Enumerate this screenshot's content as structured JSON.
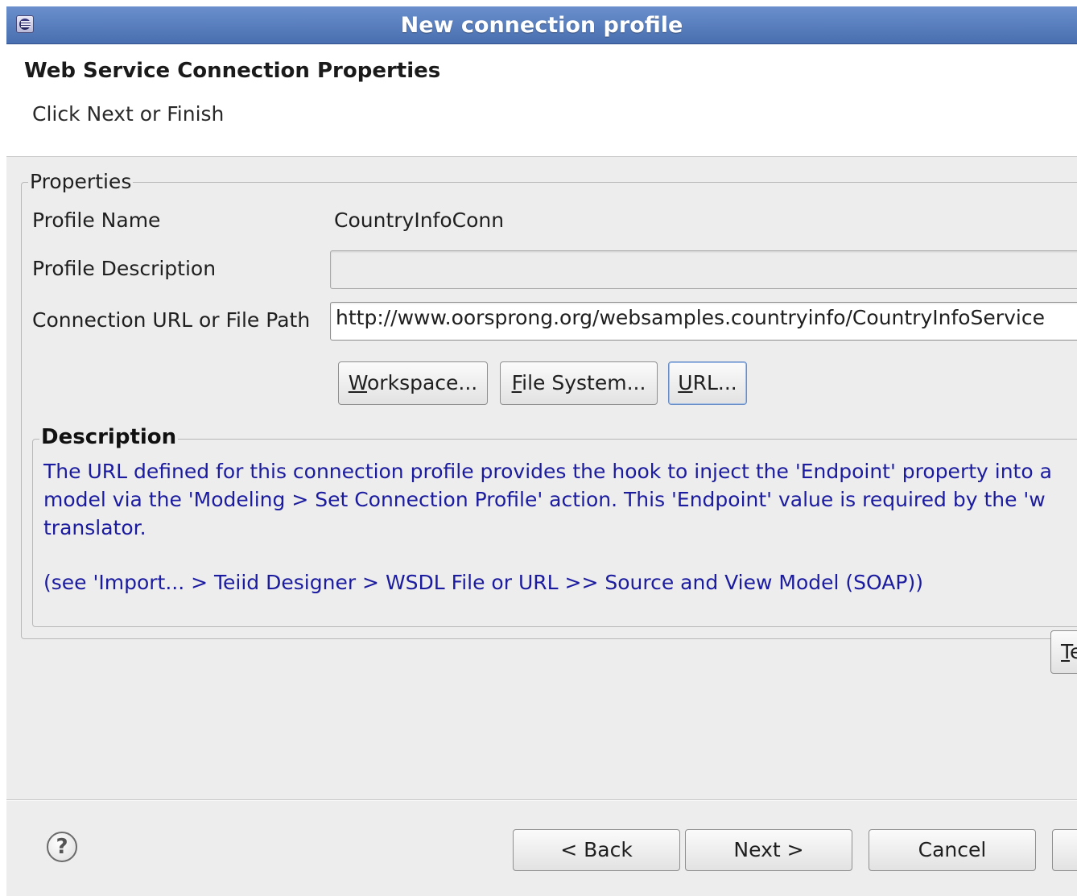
{
  "window": {
    "title": "New connection profile",
    "icon": "eclipse-app-icon"
  },
  "header": {
    "title": "Web Service Connection Properties",
    "message": "Click Next or Finish"
  },
  "properties": {
    "legend": "Properties",
    "profile_name_label": "Profile Name",
    "profile_name_value": "CountryInfoConn",
    "profile_description_label": "Profile Description",
    "profile_description_value": "",
    "connection_url_label": "Connection URL or File Path",
    "connection_url_value": "http://www.oorsprong.org/websamples.countryinfo/CountryInfoService",
    "buttons": {
      "workspace": {
        "mnemonic": "W",
        "rest": "orkspace..."
      },
      "file_system": {
        "mnemonic": "F",
        "rest": "ile System..."
      },
      "url": {
        "mnemonic": "U",
        "rest": "RL..."
      }
    }
  },
  "description": {
    "legend": "Description",
    "lines": [
      "The URL defined for this connection profile provides the hook to inject the 'Endpoint' property into a",
      "model via the 'Modeling > Set Connection Profile' action. This 'Endpoint' value is required by the 'w",
      "translator."
    ],
    "note": "(see 'Import... > Teiid Designer > WSDL File or URL >> Source and View Model (SOAP))",
    "text_color": "#1b1ba0"
  },
  "test_button": {
    "mnemonic": "T",
    "rest": "e"
  },
  "footer": {
    "help_icon": "help-icon",
    "help_glyph": "?",
    "back_label": "< Back",
    "next_label": "Next >",
    "cancel_label": "Cancel"
  },
  "colors": {
    "titlebar": "#5a7fbf",
    "dialog_bg": "#ededed",
    "banner_bg": "#ffffff"
  }
}
